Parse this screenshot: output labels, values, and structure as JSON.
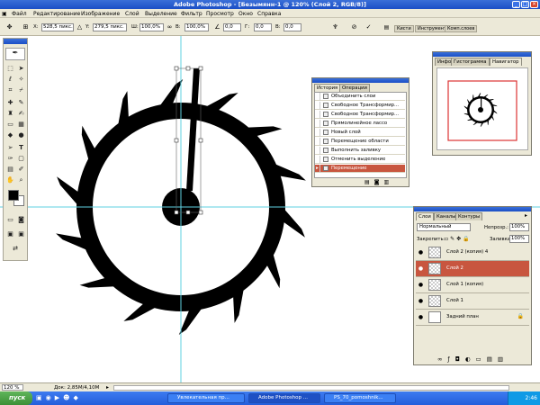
{
  "window": {
    "title": "Adobe Photoshop - [Безымянн-1 @ 120% (Слой 2, RGB/8)]"
  },
  "menu": [
    "Файл",
    "Редактирование",
    "Изображение",
    "Слой",
    "Выделение",
    "Фильтр",
    "Просмотр",
    "Окно",
    "Справка"
  ],
  "options": {
    "x_label": "X:",
    "x_value": "528,5 пикс.",
    "y_label": "Y:",
    "y_value": "279,5 пикс.",
    "w_label": "Ш:",
    "w_value": "100,0%",
    "h_label": "В:",
    "h_value": "100,0%",
    "angle_value": "0,0",
    "hskew_label": "Г:",
    "hskew_value": "0,0",
    "vskew_label": "В:",
    "vskew_value": "0,0"
  },
  "palette_well": [
    "Кисти",
    "Инструмент",
    "Комп.слоев"
  ],
  "navigator": {
    "tabs": [
      "Инфо",
      "Гистограмма",
      "Навигатор"
    ]
  },
  "history": {
    "tabs": [
      "История",
      "Операции"
    ],
    "items": [
      "Объединить слои",
      "Свободное Трансформир...",
      "Свободное Трансформир...",
      "Прямолинейное лассо",
      "Новый слой",
      "Перемещение области",
      "Выполнить заливку",
      "Отменить выделение",
      "Перемещение"
    ],
    "selected_index": 8
  },
  "layers": {
    "tabs": [
      "Слои",
      "Каналы",
      "Контуры"
    ],
    "blend_mode": "Нормальный",
    "opacity_label": "Непрозр.:",
    "opacity_value": "100%",
    "lock_label": "Закрепить:",
    "fill_label": "Заливка:",
    "fill_value": "100%",
    "items": [
      {
        "name": "Слой 2 (копия) 4",
        "selected": false
      },
      {
        "name": "Слой 2",
        "selected": true
      },
      {
        "name": "Слой 1 (копия)",
        "selected": false
      },
      {
        "name": "Слой 1",
        "selected": false
      },
      {
        "name": "Задний план",
        "selected": false,
        "locked": true
      }
    ]
  },
  "status": {
    "zoom": "120 %",
    "doc": "Док: 2,85M/4,10M"
  },
  "taskbar": {
    "start": "пуск",
    "tasks": [
      "Увлекательная пр...",
      "Adobe Photoshop ...",
      "PS_70_pomoshnik..."
    ],
    "active_task": 1,
    "clock": "2:46"
  },
  "colors": {
    "selected_row": "#c8563f",
    "title_blue": "#1b4fc6",
    "guide": "#5fd0e0"
  }
}
